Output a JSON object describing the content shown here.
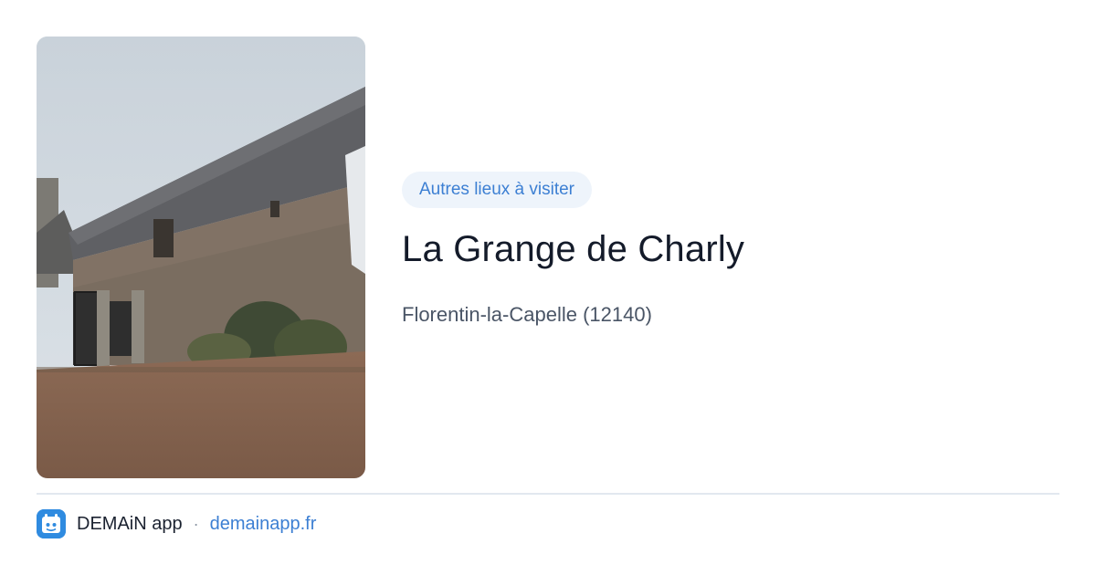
{
  "card": {
    "category": "Autres lieux à visiter",
    "title": "La Grange de Charly",
    "location": "Florentin-la-Capelle (12140)"
  },
  "footer": {
    "app_name": "DEMAiN app",
    "separator": "·",
    "link": "demainapp.fr"
  },
  "image": {
    "subject": "stone-barn-photo"
  },
  "colors": {
    "accent": "#3c7fd3",
    "pill_background": "#eef4fb",
    "title": "#141b2a",
    "subtitle": "#4a5566",
    "logo": "#2f8be0"
  }
}
